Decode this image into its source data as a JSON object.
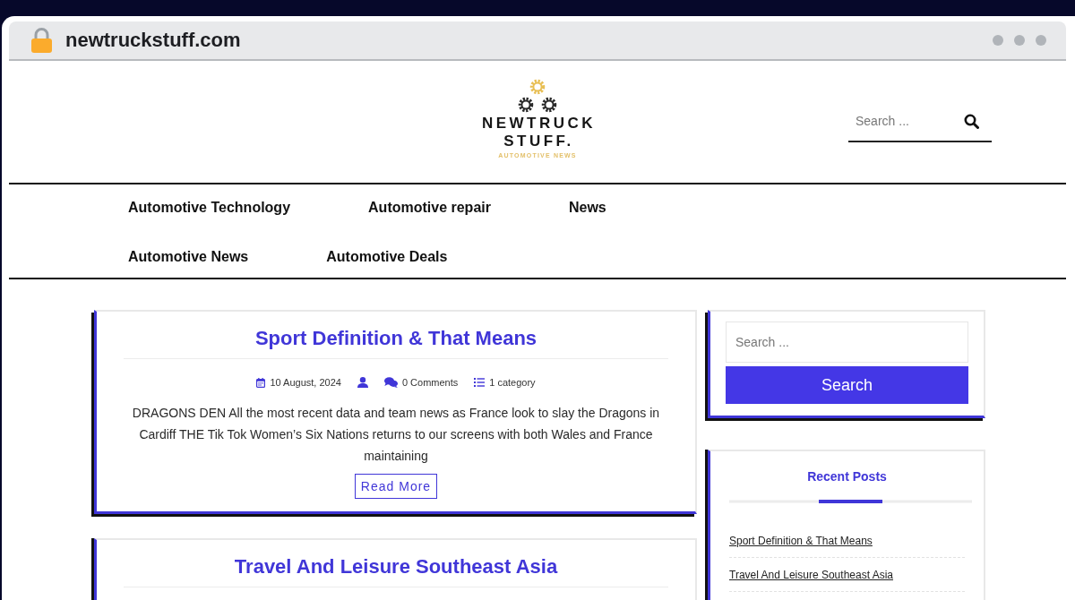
{
  "browser": {
    "url": "newtruckstuff.com"
  },
  "header": {
    "logo": {
      "line_1": "NEWTRUCK",
      "line_2": "STUFF.",
      "tagline": "AUTOMOTIVE NEWS"
    },
    "search": {
      "placeholder": "Search ..."
    }
  },
  "nav": {
    "items": [
      {
        "label": "Automotive Technology"
      },
      {
        "label": "Automotive repair"
      },
      {
        "label": "News"
      },
      {
        "label": "Automotive News"
      },
      {
        "label": "Automotive Deals"
      }
    ]
  },
  "posts": [
    {
      "title": "Sport Definition & That Means",
      "date": "10 August, 2024",
      "comments": "0 Comments",
      "categories": "1 category",
      "excerpt": "DRAGONS DEN All the most recent data and team news as France look to slay the Dragons in Cardiff THE Tik Tok Women’s Six Nations returns to our screens with both Wales and France maintaining",
      "read_more": "Read More"
    },
    {
      "title": "Travel And Leisure Southeast Asia"
    }
  ],
  "sidebar": {
    "search": {
      "placeholder": "Search ...",
      "button": "Search"
    },
    "recent_posts": {
      "title": "Recent Posts",
      "items": [
        "Sport Definition & That Means",
        "Travel And Leisure Southeast Asia"
      ]
    }
  }
}
